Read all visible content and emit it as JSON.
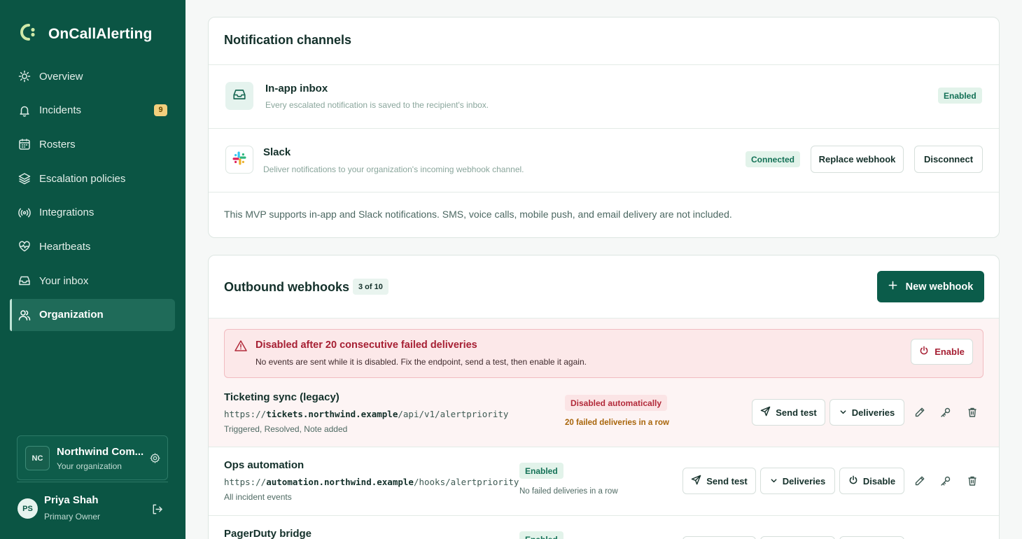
{
  "app": {
    "name": "OnCallAlerting"
  },
  "sidebar": {
    "items": [
      {
        "label": "Overview",
        "icon": "sun-icon"
      },
      {
        "label": "Incidents",
        "icon": "bell-icon",
        "badge": "9"
      },
      {
        "label": "Rosters",
        "icon": "calendar-icon"
      },
      {
        "label": "Escalation policies",
        "icon": "layers-icon"
      },
      {
        "label": "Integrations",
        "icon": "broadcast-icon"
      },
      {
        "label": "Heartbeats",
        "icon": "heart-pulse-icon"
      },
      {
        "label": "Your inbox",
        "icon": "inbox-icon"
      },
      {
        "label": "Organization",
        "icon": "users-icon",
        "active": true
      }
    ],
    "org": {
      "initials": "NC",
      "name": "Northwind Com...",
      "subtitle": "Your organization"
    },
    "user": {
      "initials": "PS",
      "name": "Priya Shah",
      "role": "Primary Owner"
    }
  },
  "notification_channels": {
    "title": "Notification channels",
    "inapp": {
      "title": "In-app inbox",
      "description": "Every escalated notification is saved to the recipient's inbox.",
      "status": "Enabled"
    },
    "slack": {
      "title": "Slack",
      "description": "Deliver notifications to your organization's incoming webhook channel.",
      "status": "Connected",
      "replace_label": "Replace webhook",
      "disconnect_label": "Disconnect"
    },
    "note": "This MVP supports in-app and Slack notifications. SMS, voice calls, mobile push, and email delivery are not included."
  },
  "webhooks": {
    "title": "Outbound webhooks",
    "count": "3 of 10",
    "new_label": "New webhook",
    "alert": {
      "title": "Disabled after 20 consecutive failed deliveries",
      "message": "No events are sent while it is disabled. Fix the endpoint, send a test, then enable it again.",
      "enable_label": "Enable"
    },
    "send_test_label": "Send test",
    "deliveries_label": "Deliveries",
    "disable_label": "Disable",
    "items": [
      {
        "name": "Ticketing sync (legacy)",
        "url_prefix": "https://",
        "url_host": "tickets.northwind.example",
        "url_path": "/api/v1/alertpriority",
        "events": "Triggered, Resolved, Note added",
        "status": "Disabled automatically",
        "status_detail": "20 failed deliveries in a row"
      },
      {
        "name": "Ops automation",
        "url_prefix": "https://",
        "url_host": "automation.northwind.example",
        "url_path": "/hooks/alertpriority",
        "events": "All incident events",
        "status": "Enabled",
        "status_detail": "No failed deliveries in a row"
      },
      {
        "name": "PagerDuty bridge",
        "status": "Enabled"
      }
    ]
  },
  "colors": {
    "sidebar": "#0b5544",
    "primary": "#0b5c4a",
    "danger": "#b22a3a",
    "warning": "#a8650a"
  }
}
